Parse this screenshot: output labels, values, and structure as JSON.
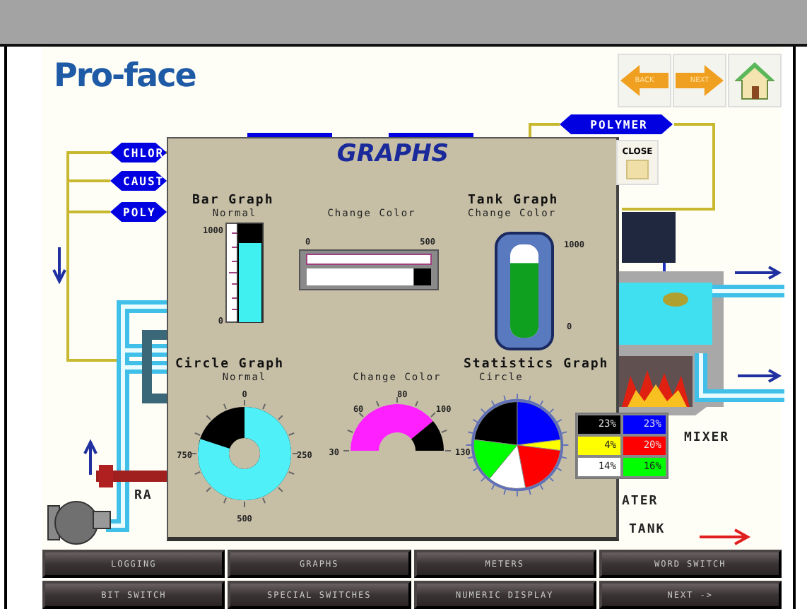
{
  "logo": "Pro-face",
  "nav_buttons": [
    {
      "kind": "back",
      "label": "BACK"
    },
    {
      "kind": "next",
      "label": "NEXT"
    },
    {
      "kind": "home"
    }
  ],
  "diagram": {
    "tags": [
      {
        "label": "CHLOR"
      },
      {
        "label": "CAUST"
      },
      {
        "label": "POLY"
      },
      {
        "label": "POLYMER"
      }
    ],
    "labels": [
      {
        "text": "RA"
      },
      {
        "text": "MIXER"
      },
      {
        "text": "ATER"
      },
      {
        "text": "TANK"
      }
    ]
  },
  "popup": {
    "title": "GRAPHS",
    "close": "CLOSE",
    "bar_graph": {
      "title": "Bar Graph",
      "normal": {
        "label": "Normal",
        "max": "1000",
        "min": "0",
        "level": 0.8
      },
      "change_color": {
        "label": "Change Color",
        "min": "0",
        "max": "500",
        "level": 0.86
      }
    },
    "tank_graph": {
      "title": "Tank Graph",
      "label": "Change Color",
      "max": "1000",
      "min": "0",
      "level": 0.8
    },
    "circle_graph": {
      "title": "Circle Graph",
      "normal": {
        "label": "Normal",
        "ticks": [
          "0",
          "250",
          "500",
          "750"
        ],
        "level": 0.8
      },
      "change_color": {
        "label": "Change Color",
        "ticks": [
          "30",
          "60",
          "80",
          "100",
          "130"
        ],
        "level": 0.78
      }
    },
    "statistics_graph": {
      "title": "Statistics Graph",
      "label": "Circle",
      "chart_data": {
        "type": "pie",
        "values": [
          23,
          23,
          4,
          20,
          14,
          16
        ]
      },
      "legend": [
        {
          "label": "23%",
          "color": "#000000"
        },
        {
          "label": "23%",
          "color": "#0000ff"
        },
        {
          "label": "4%",
          "color": "#ffff00"
        },
        {
          "label": "20%",
          "color": "#ff0000"
        },
        {
          "label": "14%",
          "color": "#ffffff"
        },
        {
          "label": "16%",
          "color": "#00ff00"
        }
      ]
    }
  },
  "menu": [
    {
      "label": "LOGGING"
    },
    {
      "label": "GRAPHS"
    },
    {
      "label": "METERS"
    },
    {
      "label": "WORD SWITCH"
    },
    {
      "label": "BIT SWITCH"
    },
    {
      "label": "SPECIAL SWITCHES"
    },
    {
      "label": "NUMERIC DISPLAY"
    },
    {
      "label": "NEXT ->"
    }
  ]
}
